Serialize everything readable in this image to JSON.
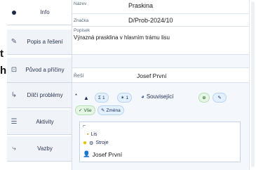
{
  "edge": {
    "letter_a": "t",
    "letter_b": "h"
  },
  "sidebar": {
    "items": [
      {
        "label": "Info",
        "icon": "info-dot-icon"
      },
      {
        "label": "Popis a řešení",
        "icon": "pencil-icon"
      },
      {
        "label": "Původ a příčiny",
        "icon": "origin-icon"
      },
      {
        "label": "Dílčí problémy",
        "icon": "subproblem-icon"
      },
      {
        "label": "Aktivity",
        "icon": "list-icon"
      },
      {
        "label": "Vazby",
        "icon": "link-icon"
      }
    ]
  },
  "fields": {
    "nazev_label": "Název",
    "nazev_value": "Praskina",
    "znacka_label": "Značka",
    "znacka_value": "D/Prob-2024/10",
    "popis_label": "Popisek",
    "popis_value": "Výrazná prasklina v hlavním trámu lisu",
    "resitel_label": "Řeší",
    "resitel_value": "Josef První"
  },
  "toolbar": {
    "marker": "*",
    "sigma_label": "1",
    "star_label": "1",
    "souvisejici_label": "Související",
    "add_icon": "plus-circle-icon",
    "edit_icon": "edit-icon",
    "vse_label": "Vše",
    "zmena_label": "Změna"
  },
  "tree": {
    "node_lis": "Lis",
    "node_stroje": "Stroje",
    "node_person": "Josef První"
  },
  "colors": {
    "accent": "#1d2b4a",
    "chip": "#e3f0ff",
    "green": "#e6f6e6"
  }
}
